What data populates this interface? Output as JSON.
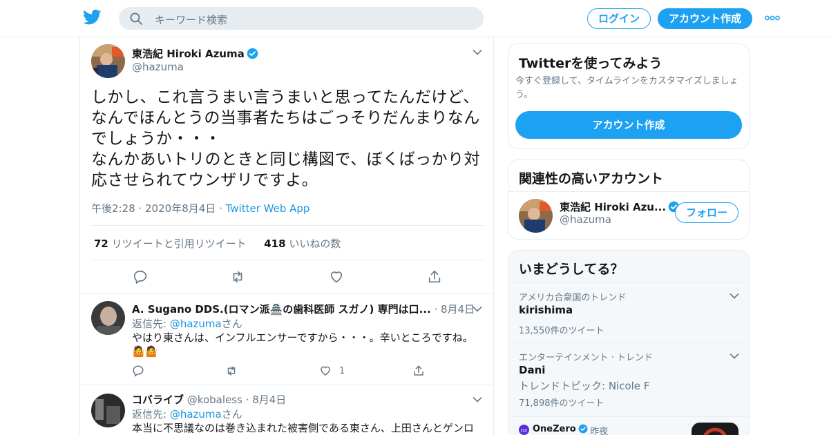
{
  "colors": {
    "accent": "#1da1f2",
    "link": "#1b95e0",
    "muted": "#657786",
    "border": "#e6ecf0",
    "text": "#14171a"
  },
  "header": {
    "logo_icon": "twitter-bird-icon",
    "search_placeholder": "キーワード検索",
    "login_label": "ログイン",
    "signup_label": "アカウント作成",
    "more_icon": "more-dots-icon"
  },
  "tweet": {
    "author_name": "東浩紀 Hiroki Azuma",
    "author_handle": "@hazuma",
    "text": "しかし、これ言うまい言うまいと思ってたんだけど、なんでほんとうの当事者たちはごっそりだんまりなんでしょうか・・・\nなんかあいトリのときと同じ構図で、ぼくばっかり対応させられてウンザリですよ。",
    "time": "午後2:28",
    "date": "2020年8月4日",
    "source": "Twitter Web App",
    "retweets_count": "72",
    "retweets_label": "リツイートと引用リツイート",
    "likes_count": "418",
    "likes_label": "いいねの数"
  },
  "replies": [
    {
      "name": "A. Sugano DDS.(ロマン派🏯の歯科医師 スガノ) 専門は口...",
      "handle": "",
      "date": "8月4日",
      "reply_prefix": "返信先: ",
      "reply_to": "@hazuma",
      "reply_suffix": "さん",
      "text": "やはり東さんは、インフルエンサーですから・・・。辛いところですね。🤷🤷",
      "like_count": "1"
    },
    {
      "name": "コバライブ",
      "handle": "@kobaless",
      "date": "8月4日",
      "reply_prefix": "返信先: ",
      "reply_to": "@hazuma",
      "reply_suffix": "さん",
      "text": "本当に不思議なのは巻き込まれた被害側である東さん、上田さんとゲンロ"
    }
  ],
  "sidebar": {
    "promo": {
      "title": "Twitterを使ってみよう",
      "description": "今すぐ登録して、タイムラインをカスタマイズしましょう。",
      "button": "アカウント作成"
    },
    "related": {
      "title": "関連性の高いアカウント",
      "name": "東浩紀 Hiroki Azu...",
      "handle": "@hazuma",
      "follow": "フォロー"
    },
    "trends": {
      "title": "いまどうしてる？",
      "items": [
        {
          "context": "アメリカ合衆国のトレンド",
          "name": "kirishima",
          "count": "13,550件のツイート"
        },
        {
          "context": "エンターテインメント · トレンド",
          "name": "Dani",
          "sub": "トレンドトピック: Nicole F",
          "count": "71,898件のツイート"
        }
      ],
      "news": {
        "source": "OneZero",
        "time": "昨夜"
      }
    }
  }
}
